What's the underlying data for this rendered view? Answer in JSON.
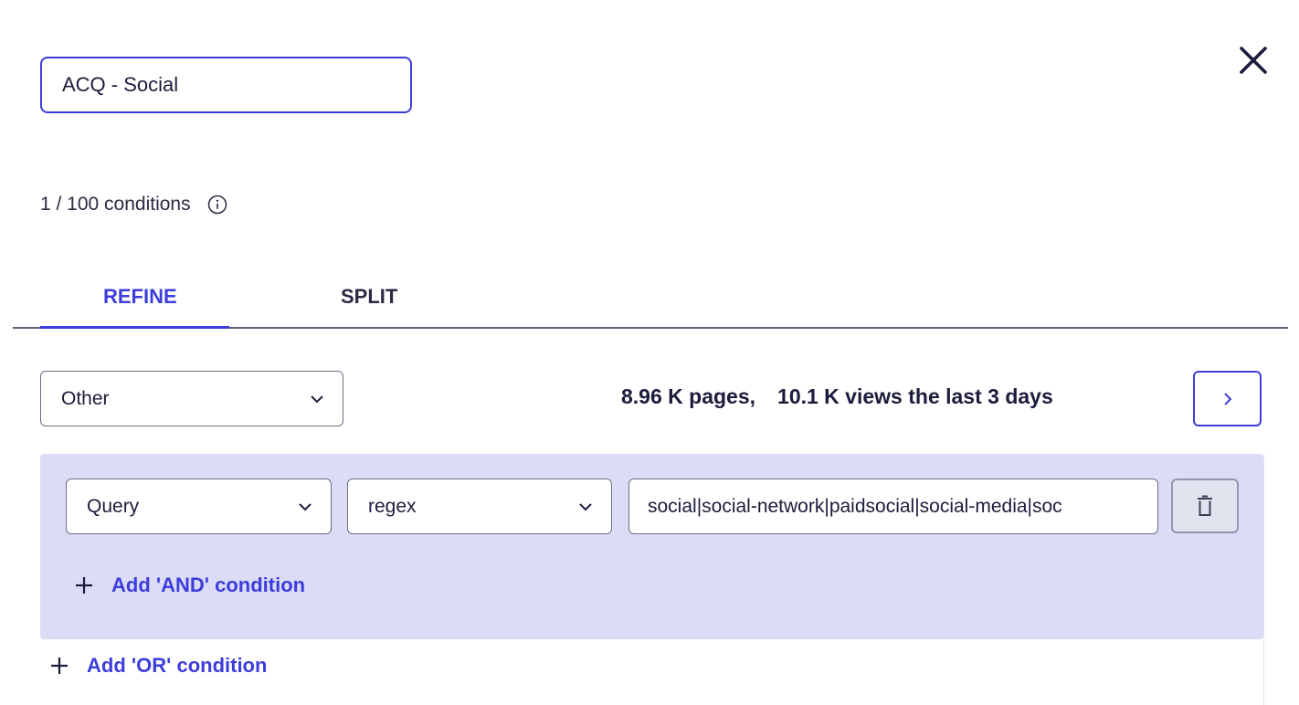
{
  "segment": {
    "name": "ACQ - Social"
  },
  "conditions_count": "1 / 100 conditions",
  "tabs": [
    {
      "label": "REFINE",
      "active": true
    },
    {
      "label": "SPLIT",
      "active": false
    }
  ],
  "scope_select": {
    "value": "Other"
  },
  "stats": {
    "pages": "8.96 K pages,",
    "views": "10.1 K views the last 3 days"
  },
  "condition": {
    "field": "Query",
    "operator": "regex",
    "value": "social|social-network|paidsocial|social-media|soc"
  },
  "links": {
    "add_and": "Add 'AND' condition",
    "add_or": "Add 'OR' condition"
  },
  "icons": {
    "close": "close-icon",
    "info": "info-icon",
    "chevron": "chevron-down-icon",
    "next": "chevron-right-icon",
    "delete": "trash-icon",
    "plus": "plus-icon"
  },
  "colors": {
    "accent": "#3d3ddc",
    "group_bg": "#dcdcf7",
    "text": "#1c1c3c"
  }
}
